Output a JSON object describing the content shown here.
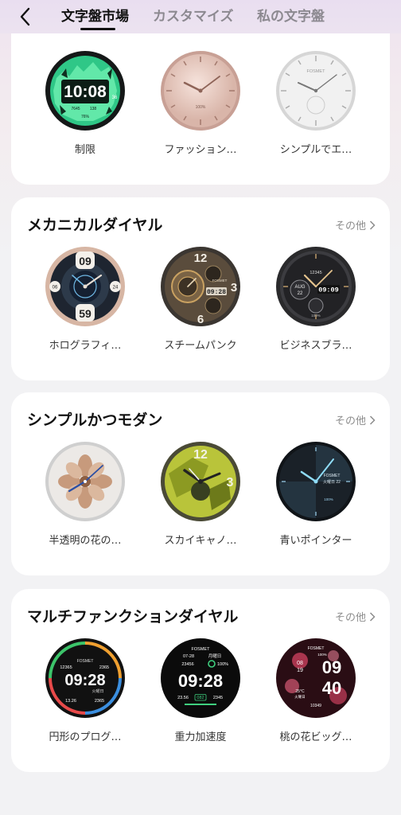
{
  "header": {
    "tabs": [
      {
        "label": "文字盤市場"
      },
      {
        "label": "カスタマイズ"
      },
      {
        "label": "私の文字盤"
      }
    ]
  },
  "sections": [
    {
      "items": [
        {
          "label": "制限",
          "face": {
            "t1": "10:08",
            "t2": "36",
            "t3": "7645",
            "t4": "138",
            "t5": "76%"
          }
        },
        {
          "label": "ファッション…",
          "face": {
            "t1": "100%"
          }
        },
        {
          "label": "シンプルでエ…",
          "face": {
            "t1": "FOSMET"
          }
        }
      ]
    },
    {
      "title": "メカニカルダイヤル",
      "more": "その他",
      "items": [
        {
          "label": "ホログラフィ…",
          "face": {
            "t1": "09",
            "t2": "59",
            "t3": "06",
            "t4": "24"
          }
        },
        {
          "label": "スチームパンク",
          "face": {
            "t1": "12",
            "t2": "3",
            "t3": "6",
            "t4": "09:28",
            "t5": "FOSMET"
          }
        },
        {
          "label": "ビジネスブラ…",
          "face": {
            "t1": "AUG",
            "t2": "22",
            "t3": "09:09",
            "t4": "12345",
            "t5": "100%"
          }
        }
      ]
    },
    {
      "title": "シンプルかつモダン",
      "more": "その他",
      "items": [
        {
          "label": "半透明の花の…",
          "face": {}
        },
        {
          "label": "スカイキャノ…",
          "face": {
            "t1": "12",
            "t2": "3"
          }
        },
        {
          "label": "青いポインター",
          "face": {
            "t1": "FOSMET",
            "t2": "火曜日 22",
            "t3": "100%"
          }
        }
      ]
    },
    {
      "title": "マルチファンクションダイヤル",
      "more": "その他",
      "items": [
        {
          "label": "円形のプログ…",
          "face": {
            "t1": "09:28",
            "t2": "12365",
            "t3": "2365",
            "t4": "FOSMET",
            "t5": "13.26",
            "t6": "火曜日",
            "t7": "2365"
          }
        },
        {
          "label": "重力加速度",
          "face": {
            "t1": "09:28",
            "t2": "FOSMET",
            "t3": "07-28",
            "t4": "月曜日",
            "t5": "23456",
            "t6": "100%",
            "t7": "23.56",
            "t8": "082",
            "t9": "2345"
          }
        },
        {
          "label": "桃の花ビッグ…",
          "face": {
            "t1": "09",
            "t2": "40",
            "t3": "FOSMET",
            "t4": "08",
            "t5": "19",
            "t6": "100%",
            "t7": "25°C",
            "t8": "火曜日",
            "t9": "10349"
          }
        }
      ]
    }
  ],
  "colors": {
    "accent": "#111111",
    "muted": "#8c8990",
    "card": "#ffffff",
    "background": "#f2f2f4"
  }
}
